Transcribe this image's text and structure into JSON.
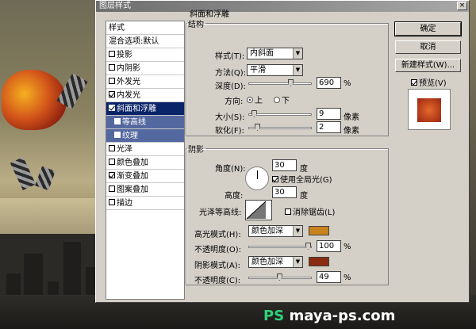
{
  "dialog": {
    "title": "图层样式",
    "close": "×"
  },
  "left_panel": {
    "header": "样式",
    "blend": "混合选项:默认",
    "items": [
      {
        "label": "投影",
        "checked": false
      },
      {
        "label": "内阴影",
        "checked": false
      },
      {
        "label": "外发光",
        "checked": false
      },
      {
        "label": "内发光",
        "checked": true
      },
      {
        "label": "斜面和浮雕",
        "checked": true,
        "selected": true
      },
      {
        "label": "等高线",
        "checked": false,
        "sub": true
      },
      {
        "label": "纹理",
        "checked": false,
        "sub": true
      },
      {
        "label": "光泽",
        "checked": false
      },
      {
        "label": "颜色叠加",
        "checked": false
      },
      {
        "label": "渐变叠加",
        "checked": true
      },
      {
        "label": "图案叠加",
        "checked": false
      },
      {
        "label": "描边",
        "checked": false
      }
    ]
  },
  "bevel": {
    "title": "斜面和浮雕",
    "structure_title": "结构",
    "style_label": "样式(T):",
    "style_value": "内斜面",
    "method_label": "方法(Q):",
    "method_value": "平滑",
    "depth_label": "深度(D):",
    "depth_value": "690",
    "depth_unit": "%",
    "depth_fraction": 0.69,
    "direction_label": "方向:",
    "dir_up": "上",
    "dir_down": "下",
    "direction": "上",
    "size_label": "大小(S):",
    "size_value": "9",
    "size_unit": "像素",
    "size_fraction": 0.04,
    "soften_label": "软化(F):",
    "soften_value": "2",
    "soften_unit": "像素",
    "soften_fraction": 0.1
  },
  "shading": {
    "title": "阴影",
    "angle_label": "角度(N):",
    "angle_value": "30",
    "angle_unit": "度",
    "global_label": "使用全局光(G)",
    "global_checked": true,
    "altitude_label": "高度:",
    "altitude_value": "30",
    "altitude_unit": "度",
    "gloss_label": "光泽等高线:",
    "antialias_label": "消除锯齿(L)",
    "antialias_checked": false,
    "hl_mode_label": "高光模式(H):",
    "hl_mode_value": "颜色加深",
    "hl_color": "#c8821e",
    "hl_opacity_label": "不透明度(O):",
    "hl_opacity_value": "100",
    "hl_opacity_unit": "%",
    "hl_opacity_fraction": 1.0,
    "sh_mode_label": "阴影模式(A):",
    "sh_mode_value": "颜色加深",
    "sh_color": "#8a2a10",
    "sh_opacity_label": "不透明度(C):",
    "sh_opacity_value": "49",
    "sh_opacity_unit": "%",
    "sh_opacity_fraction": 0.49
  },
  "buttons": {
    "ok": "确定",
    "cancel": "取消",
    "new_style": "新建样式(W)...",
    "preview_label": "预览(V)",
    "preview_checked": true
  },
  "watermark": {
    "mark": "PS",
    "text": "maya-ps.com"
  }
}
